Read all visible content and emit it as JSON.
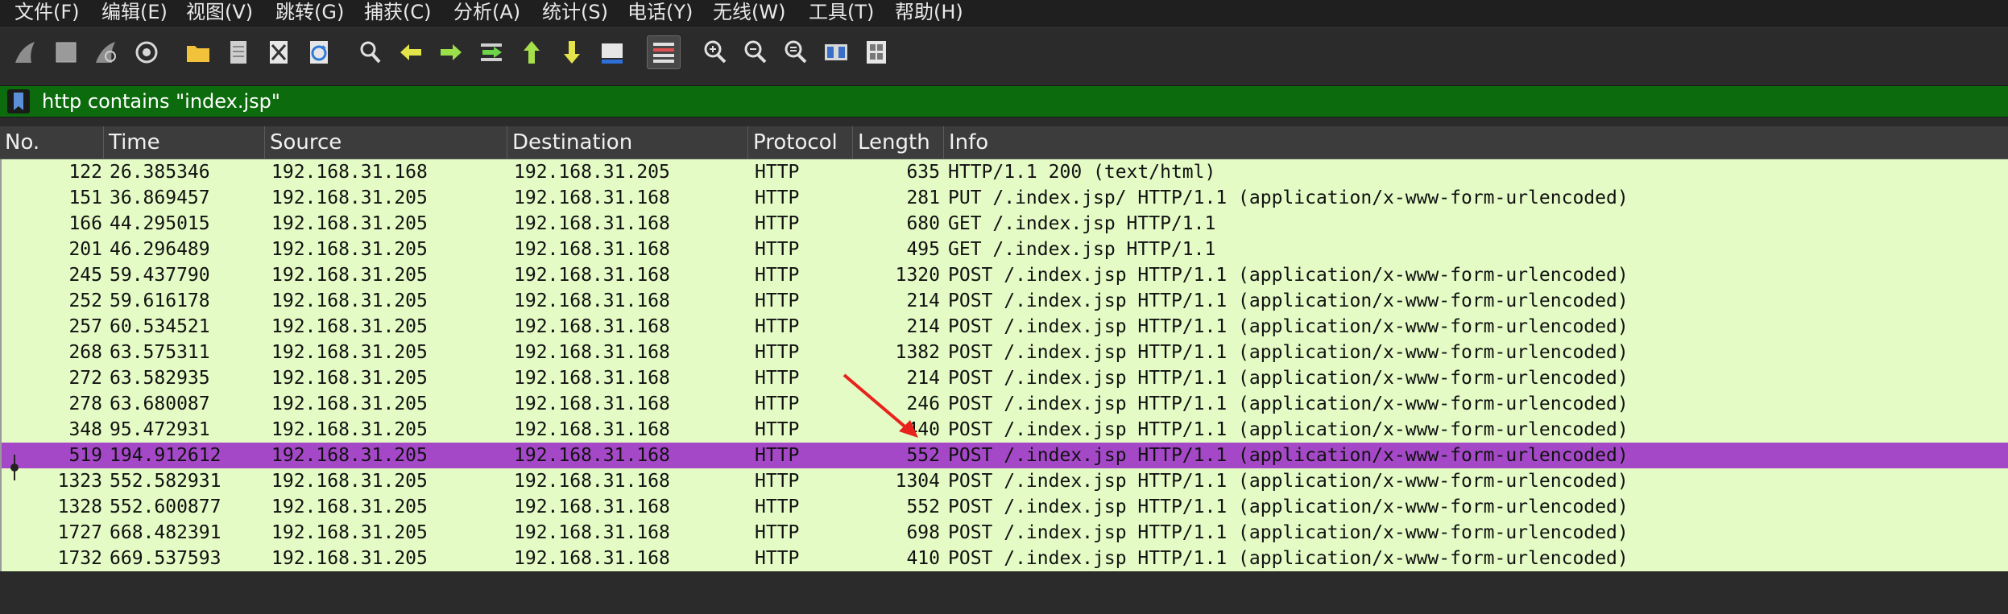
{
  "menu": [
    "文件(F)",
    "编辑(E)",
    "视图(V)",
    "跳转(G)",
    "捕获(C)",
    "分析(A)",
    "统计(S)",
    "电话(Y)",
    "无线(W)",
    "工具(T)",
    "帮助(H)"
  ],
  "toolbar": {
    "icons": [
      "shark-fin-start-icon",
      "stop-square-icon",
      "shark-fin-restart-icon",
      "capture-options-gear-icon",
      "open-folder-icon",
      "save-file-icon",
      "close-file-icon",
      "reload-icon",
      "find-magnifier-icon",
      "go-back-arrow-icon",
      "go-forward-arrow-icon",
      "go-to-packet-icon",
      "go-first-packet-icon",
      "go-last-packet-icon",
      "autoscroll-icon",
      "colorize-list-icon",
      "zoom-in-icon",
      "zoom-out-icon",
      "zoom-normal-icon",
      "resize-columns-icon",
      "time-format-icon"
    ]
  },
  "filter": {
    "text": "http contains \"index.jsp\"",
    "bar_color": "#0c6b0c"
  },
  "columns": [
    "No.",
    "Time",
    "Source",
    "Destination",
    "Protocol",
    "Length",
    "Info"
  ],
  "packets": [
    {
      "no": "122",
      "time": "26.385346",
      "src": "192.168.31.168",
      "dst": "192.168.31.205",
      "proto": "HTTP",
      "len": "635",
      "info": "HTTP/1.1 200   (text/html)"
    },
    {
      "no": "151",
      "time": "36.869457",
      "src": "192.168.31.205",
      "dst": "192.168.31.168",
      "proto": "HTTP",
      "len": "281",
      "info": "PUT /.index.jsp/ HTTP/1.1  (application/x-www-form-urlencoded)"
    },
    {
      "no": "166",
      "time": "44.295015",
      "src": "192.168.31.205",
      "dst": "192.168.31.168",
      "proto": "HTTP",
      "len": "680",
      "info": "GET /.index.jsp HTTP/1.1"
    },
    {
      "no": "201",
      "time": "46.296489",
      "src": "192.168.31.205",
      "dst": "192.168.31.168",
      "proto": "HTTP",
      "len": "495",
      "info": "GET /.index.jsp HTTP/1.1"
    },
    {
      "no": "245",
      "time": "59.437790",
      "src": "192.168.31.205",
      "dst": "192.168.31.168",
      "proto": "HTTP",
      "len": "1320",
      "info": "POST /.index.jsp HTTP/1.1  (application/x-www-form-urlencoded)"
    },
    {
      "no": "252",
      "time": "59.616178",
      "src": "192.168.31.205",
      "dst": "192.168.31.168",
      "proto": "HTTP",
      "len": "214",
      "info": "POST /.index.jsp HTTP/1.1  (application/x-www-form-urlencoded)"
    },
    {
      "no": "257",
      "time": "60.534521",
      "src": "192.168.31.205",
      "dst": "192.168.31.168",
      "proto": "HTTP",
      "len": "214",
      "info": "POST /.index.jsp HTTP/1.1  (application/x-www-form-urlencoded)"
    },
    {
      "no": "268",
      "time": "63.575311",
      "src": "192.168.31.205",
      "dst": "192.168.31.168",
      "proto": "HTTP",
      "len": "1382",
      "info": "POST /.index.jsp HTTP/1.1  (application/x-www-form-urlencoded)"
    },
    {
      "no": "272",
      "time": "63.582935",
      "src": "192.168.31.205",
      "dst": "192.168.31.168",
      "proto": "HTTP",
      "len": "214",
      "info": "POST /.index.jsp HTTP/1.1  (application/x-www-form-urlencoded)"
    },
    {
      "no": "278",
      "time": "63.680087",
      "src": "192.168.31.205",
      "dst": "192.168.31.168",
      "proto": "HTTP",
      "len": "246",
      "info": "POST /.index.jsp HTTP/1.1  (application/x-www-form-urlencoded)"
    },
    {
      "no": "348",
      "time": "95.472931",
      "src": "192.168.31.205",
      "dst": "192.168.31.168",
      "proto": "HTTP",
      "len": "440",
      "info": "POST /.index.jsp HTTP/1.1  (application/x-www-form-urlencoded)"
    },
    {
      "no": "519",
      "time": "194.912612",
      "src": "192.168.31.205",
      "dst": "192.168.31.168",
      "proto": "HTTP",
      "len": "552",
      "info": "POST /.index.jsp HTTP/1.1  (application/x-www-form-urlencoded)",
      "selected": true
    },
    {
      "no": "1323",
      "time": "552.582931",
      "src": "192.168.31.205",
      "dst": "192.168.31.168",
      "proto": "HTTP",
      "len": "1304",
      "info": "POST /.index.jsp HTTP/1.1  (application/x-www-form-urlencoded)"
    },
    {
      "no": "1328",
      "time": "552.600877",
      "src": "192.168.31.205",
      "dst": "192.168.31.168",
      "proto": "HTTP",
      "len": "552",
      "info": "POST /.index.jsp HTTP/1.1  (application/x-www-form-urlencoded)"
    },
    {
      "no": "1727",
      "time": "668.482391",
      "src": "192.168.31.205",
      "dst": "192.168.31.168",
      "proto": "HTTP",
      "len": "698",
      "info": "POST /.index.jsp HTTP/1.1  (application/x-www-form-urlencoded)"
    },
    {
      "no": "1732",
      "time": "669.537593",
      "src": "192.168.31.205",
      "dst": "192.168.31.168",
      "proto": "HTTP",
      "len": "410",
      "info": "POST /.index.jsp HTTP/1.1  (application/x-www-form-urlencoded)"
    }
  ],
  "colors": {
    "row_bg": "#e4fbc5",
    "selected_bg": "#a548c8",
    "annotation_arrow": "#e8221c"
  }
}
